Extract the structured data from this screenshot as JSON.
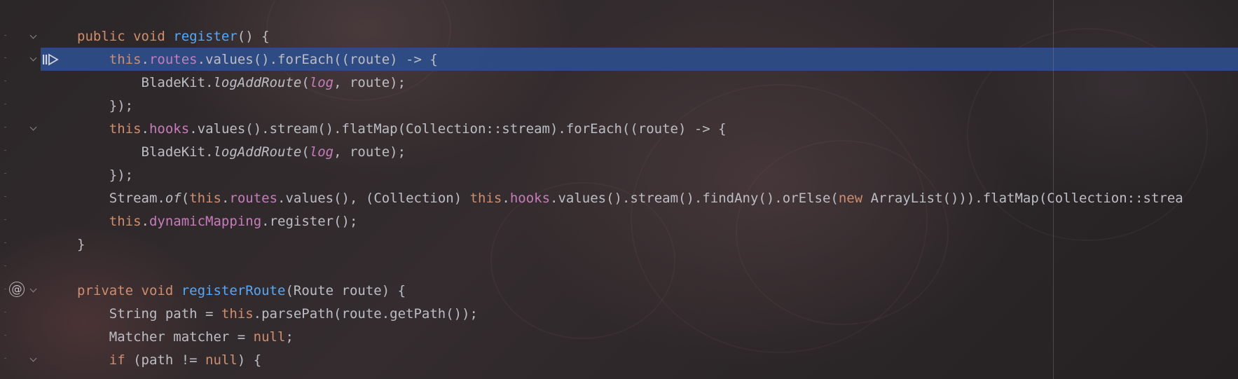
{
  "editor": {
    "language": "Java",
    "colors": {
      "background": "#2a2628",
      "keyword": "#cf8e6d",
      "method_declaration": "#56a8f5",
      "field": "#c77dbb",
      "text": "#bcbec4",
      "execution_line_highlight": "#2e4d8a"
    },
    "current_execution_line_index": 1,
    "gutter_icons": {
      "execution_point": "execution-point-icon",
      "annotation_marker": "at-sign-icon",
      "fold": "chevron-down-icon"
    },
    "lines": [
      {
        "tokens": [
          {
            "t": "public void ",
            "c": "kw"
          },
          {
            "t": "register",
            "c": "fn"
          },
          {
            "t": "() {",
            "c": "tx"
          }
        ]
      },
      {
        "tokens": [
          {
            "t": "    "
          },
          {
            "t": "this",
            "c": "kw"
          },
          {
            "t": ".",
            "c": "tx"
          },
          {
            "t": "routes",
            "c": "fld"
          },
          {
            "t": ".values().forEach((route) -> {",
            "c": "tx"
          }
        ]
      },
      {
        "tokens": [
          {
            "t": "        BladeKit.",
            "c": "tx"
          },
          {
            "t": "logAddRoute",
            "c": "it"
          },
          {
            "t": "(",
            "c": "tx"
          },
          {
            "t": "log",
            "c": "itf"
          },
          {
            "t": ", route);",
            "c": "tx"
          }
        ]
      },
      {
        "tokens": [
          {
            "t": "    });",
            "c": "tx"
          }
        ]
      },
      {
        "tokens": [
          {
            "t": "    "
          },
          {
            "t": "this",
            "c": "kw"
          },
          {
            "t": ".",
            "c": "tx"
          },
          {
            "t": "hooks",
            "c": "fld"
          },
          {
            "t": ".values().stream().flatMap(Collection::stream).forEach((route) -> {",
            "c": "tx"
          }
        ]
      },
      {
        "tokens": [
          {
            "t": "        BladeKit.",
            "c": "tx"
          },
          {
            "t": "logAddRoute",
            "c": "it"
          },
          {
            "t": "(",
            "c": "tx"
          },
          {
            "t": "log",
            "c": "itf"
          },
          {
            "t": ", route);",
            "c": "tx"
          }
        ]
      },
      {
        "tokens": [
          {
            "t": "    });",
            "c": "tx"
          }
        ]
      },
      {
        "tokens": [
          {
            "t": "    Stream.",
            "c": "tx"
          },
          {
            "t": "of",
            "c": "it"
          },
          {
            "t": "(",
            "c": "tx"
          },
          {
            "t": "this",
            "c": "kw"
          },
          {
            "t": ".",
            "c": "tx"
          },
          {
            "t": "routes",
            "c": "fld"
          },
          {
            "t": ".values(), (Collection) ",
            "c": "tx"
          },
          {
            "t": "this",
            "c": "kw"
          },
          {
            "t": ".",
            "c": "tx"
          },
          {
            "t": "hooks",
            "c": "fld"
          },
          {
            "t": ".values().stream().findAny().orElse(",
            "c": "tx"
          },
          {
            "t": "new",
            "c": "kw"
          },
          {
            "t": " ArrayList())).flatMap(Collection::strea",
            "c": "tx"
          }
        ]
      },
      {
        "tokens": [
          {
            "t": "    "
          },
          {
            "t": "this",
            "c": "kw"
          },
          {
            "t": ".",
            "c": "tx"
          },
          {
            "t": "dynamicMapping",
            "c": "fld"
          },
          {
            "t": ".register();",
            "c": "tx"
          }
        ]
      },
      {
        "tokens": [
          {
            "t": "}",
            "c": "tx"
          }
        ]
      },
      {
        "tokens": [
          {
            "t": "",
            "c": "tx"
          }
        ]
      },
      {
        "tokens": [
          {
            "t": "private void ",
            "c": "kw"
          },
          {
            "t": "registerRoute",
            "c": "fn"
          },
          {
            "t": "(Route route) {",
            "c": "tx"
          }
        ]
      },
      {
        "tokens": [
          {
            "t": "    String path = ",
            "c": "tx"
          },
          {
            "t": "this",
            "c": "kw"
          },
          {
            "t": ".parsePath(route.getPath());",
            "c": "tx"
          }
        ]
      },
      {
        "tokens": [
          {
            "t": "    Matcher matcher = ",
            "c": "tx"
          },
          {
            "t": "null",
            "c": "kw"
          },
          {
            "t": ";",
            "c": "tx"
          }
        ]
      },
      {
        "tokens": [
          {
            "t": "    "
          },
          {
            "t": "if",
            "c": "kw"
          },
          {
            "t": " (path != ",
            "c": "tx"
          },
          {
            "t": "null",
            "c": "kw"
          },
          {
            "t": ") {",
            "c": "tx"
          }
        ]
      }
    ]
  }
}
